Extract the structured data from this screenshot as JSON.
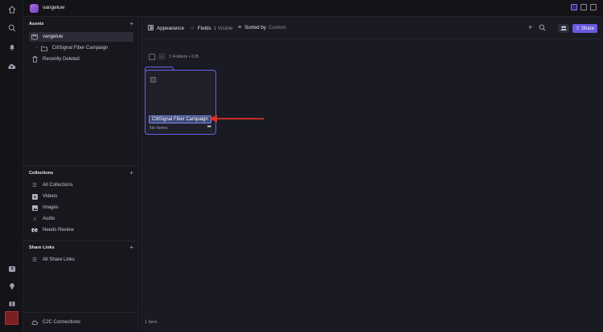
{
  "rail": {
    "icons": [
      "home-icon",
      "search-icon",
      "bell-icon",
      "cloud-upload-icon",
      "help-icon",
      "lightbulb-icon",
      "gift-icon"
    ]
  },
  "topbar": {
    "workspace_name": "vangeluw"
  },
  "sidebar": {
    "assets_header": "Assets",
    "assets": [
      {
        "label": "vangeluw",
        "icon": "library-icon"
      },
      {
        "label": "CitiSignal Fiber Campaign",
        "icon": "folder-icon"
      },
      {
        "label": "Recently Deleted",
        "icon": "trash-icon"
      }
    ],
    "collections_header": "Collections",
    "collections": [
      {
        "label": "All Collections",
        "icon": "list-icon"
      },
      {
        "label": "Videos",
        "icon": "video-icon"
      },
      {
        "label": "Images",
        "icon": "image-icon"
      },
      {
        "label": "Audio",
        "icon": "audio-icon"
      },
      {
        "label": "Needs Review",
        "icon": "eyes-icon"
      }
    ],
    "share_links_header": "Share Links",
    "share_links": [
      {
        "label": "All Share Links",
        "icon": "list-icon"
      }
    ],
    "c2c_label": "C2C Connections"
  },
  "toolbar": {
    "appearance_label": "Appearance",
    "fields_label": "Fields",
    "fields_count": "1 Visible",
    "sorted_label": "Sorted by",
    "sorted_value": "Custom",
    "share_label": "Share"
  },
  "content": {
    "selection_info": "1 Folders • 0 B",
    "folder": {
      "name": "CitiSignal Fiber Campaign",
      "item_count": "No Items"
    },
    "footer_count": "1 Item"
  },
  "colors": {
    "accent": "#6b5ee8",
    "annotation_arrow": "#e0302a"
  }
}
